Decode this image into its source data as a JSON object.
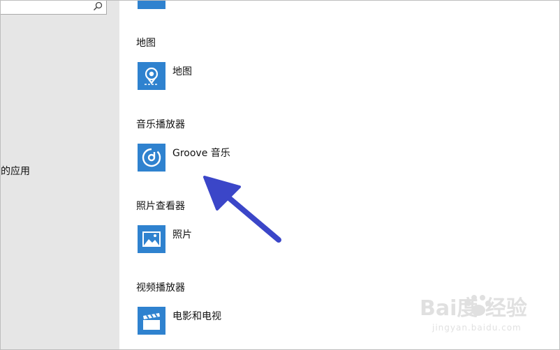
{
  "sidebar": {
    "search": {
      "placeholder": ""
    },
    "nav_item_label": "默认的应用"
  },
  "categories": [
    {
      "title": "地图",
      "app": {
        "label": "地图",
        "icon": "map-pin-icon"
      }
    },
    {
      "title": "音乐播放器",
      "app": {
        "label": "Groove 音乐",
        "icon": "groove-music-icon"
      }
    },
    {
      "title": "照片查看器",
      "app": {
        "label": "照片",
        "icon": "photos-icon"
      }
    },
    {
      "title": "视频播放器",
      "app": {
        "label": "电影和电视",
        "icon": "movies-tv-icon"
      }
    }
  ],
  "annotation": {
    "type": "arrow",
    "color": "#3b46c8"
  },
  "watermark": {
    "brand": "Bai度 经验",
    "url": "jingyan.baidu.com"
  },
  "colors": {
    "tile": "#2f82cf",
    "sidebar_bg": "#e6e6e6",
    "arrow": "#3b46c8"
  }
}
